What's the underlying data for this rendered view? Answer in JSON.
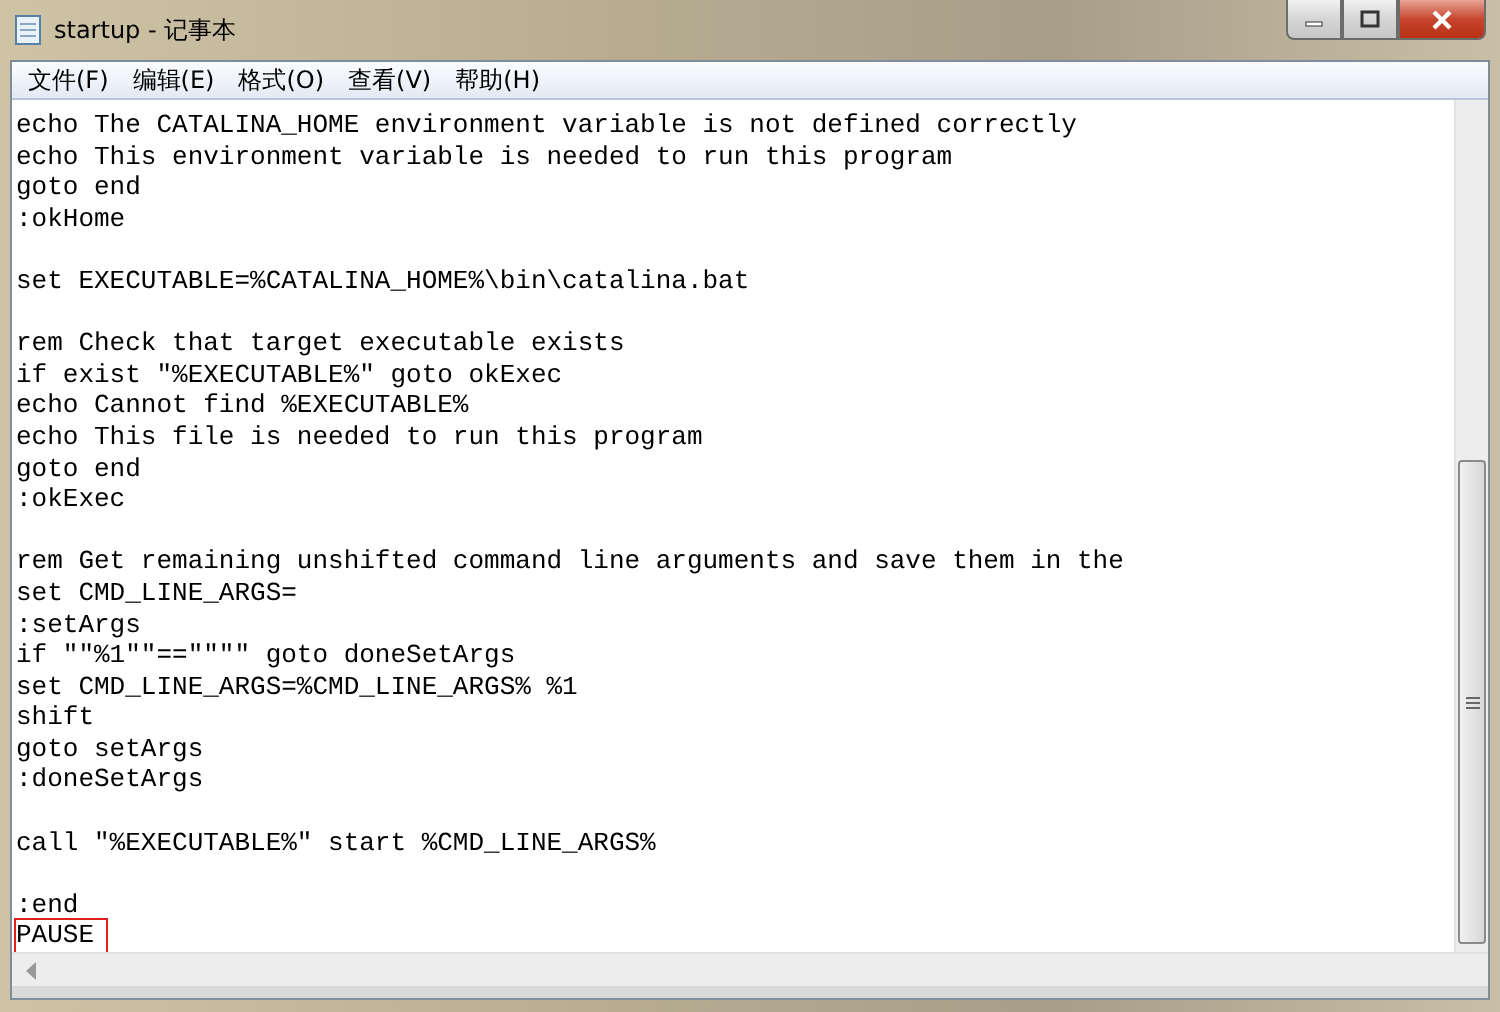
{
  "window": {
    "title": "startup - 记事本"
  },
  "menu": [
    "文件(F)",
    "编辑(E)",
    "格式(O)",
    "查看(V)",
    "帮助(H)"
  ],
  "lines": [
    {
      "kind": "code",
      "text": "echo The CATALINA_HOME environment variable is not defined correctly",
      "highlighted": false
    },
    {
      "kind": "code",
      "text": "echo This environment variable is needed to run this program",
      "highlighted": false
    },
    {
      "kind": "code",
      "text": "goto end",
      "highlighted": false
    },
    {
      "kind": "code",
      "text": ":okHome",
      "highlighted": false
    },
    {
      "kind": "blank"
    },
    {
      "kind": "code",
      "text": "set EXECUTABLE=%CATALINA_HOME%\\bin\\catalina.bat",
      "highlighted": false
    },
    {
      "kind": "blank"
    },
    {
      "kind": "code",
      "text": "rem Check that target executable exists",
      "highlighted": false
    },
    {
      "kind": "code",
      "text": "if exist \"%EXECUTABLE%\" goto okExec",
      "highlighted": false
    },
    {
      "kind": "code",
      "text": "echo Cannot find %EXECUTABLE%",
      "highlighted": false
    },
    {
      "kind": "code",
      "text": "echo This file is needed to run this program",
      "highlighted": false
    },
    {
      "kind": "code",
      "text": "goto end",
      "highlighted": false
    },
    {
      "kind": "code",
      "text": ":okExec",
      "highlighted": false
    },
    {
      "kind": "blank"
    },
    {
      "kind": "code",
      "text": "rem Get remaining unshifted command line arguments and save them in the",
      "highlighted": false
    },
    {
      "kind": "code",
      "text": "set CMD_LINE_ARGS=",
      "highlighted": false
    },
    {
      "kind": "code",
      "text": ":setArgs",
      "highlighted": false
    },
    {
      "kind": "code",
      "text": "if \"\"%1\"\"==\"\"\"\" goto doneSetArgs",
      "highlighted": false
    },
    {
      "kind": "code",
      "text": "set CMD_LINE_ARGS=%CMD_LINE_ARGS% %1",
      "highlighted": false
    },
    {
      "kind": "code",
      "text": "shift",
      "highlighted": false
    },
    {
      "kind": "code",
      "text": "goto setArgs",
      "highlighted": false
    },
    {
      "kind": "code",
      "text": ":doneSetArgs",
      "highlighted": false
    },
    {
      "kind": "blank"
    },
    {
      "kind": "code",
      "text": "call \"%EXECUTABLE%\" start %CMD_LINE_ARGS%",
      "highlighted": false
    },
    {
      "kind": "blank"
    },
    {
      "kind": "code",
      "text": ":end",
      "highlighted": false
    },
    {
      "kind": "code",
      "text": "PAUSE",
      "highlighted": true
    }
  ]
}
